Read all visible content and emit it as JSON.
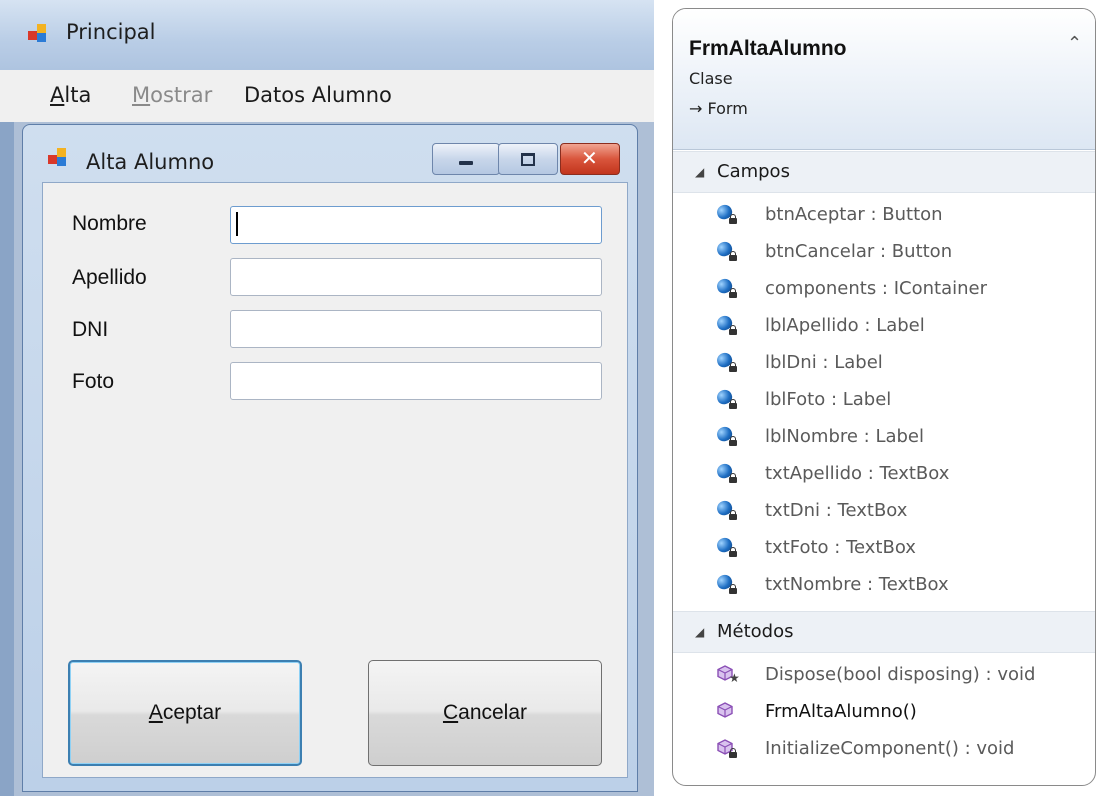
{
  "principal": {
    "title": "Principal",
    "menu": {
      "alta": {
        "u": "A",
        "rest": "lta"
      },
      "mostrar": {
        "u": "M",
        "rest": "ostrar"
      },
      "datos": "Datos Alumno"
    }
  },
  "alta_window": {
    "title": "Alta Alumno",
    "labels": {
      "nombre": "Nombre",
      "apellido": "Apellido",
      "dni": "DNI",
      "foto": "Foto"
    },
    "fields": {
      "nombre": "",
      "apellido": "",
      "dni": "",
      "foto": ""
    },
    "buttons": {
      "aceptar": {
        "u": "A",
        "rest": "ceptar"
      },
      "cancelar": {
        "u": "C",
        "rest": "ancelar"
      }
    }
  },
  "class_diagram": {
    "name": "FrmAltaAlumno",
    "kind": "Clase",
    "base": "→ Form",
    "sections": {
      "fields_title": "Campos",
      "methods_title": "Métodos"
    },
    "fields": [
      "btnAceptar : Button",
      "btnCancelar : Button",
      "components : IContainer",
      "lblApellido : Label",
      "lblDni : Label",
      "lblFoto : Label",
      "lblNombre : Label",
      "txtApellido : TextBox",
      "txtDni : TextBox",
      "txtFoto : TextBox",
      "txtNombre : TextBox"
    ],
    "methods": [
      "Dispose(bool disposing) : void",
      "FrmAltaAlumno()",
      "InitializeComponent() : void"
    ]
  },
  "colors": {
    "titlebar": "#c7d8ee",
    "close_button": "#c9432b",
    "focus_border": "#3c7fb1",
    "field_icon": "#1f6fc4",
    "method_icon": "#8a4fb5"
  }
}
